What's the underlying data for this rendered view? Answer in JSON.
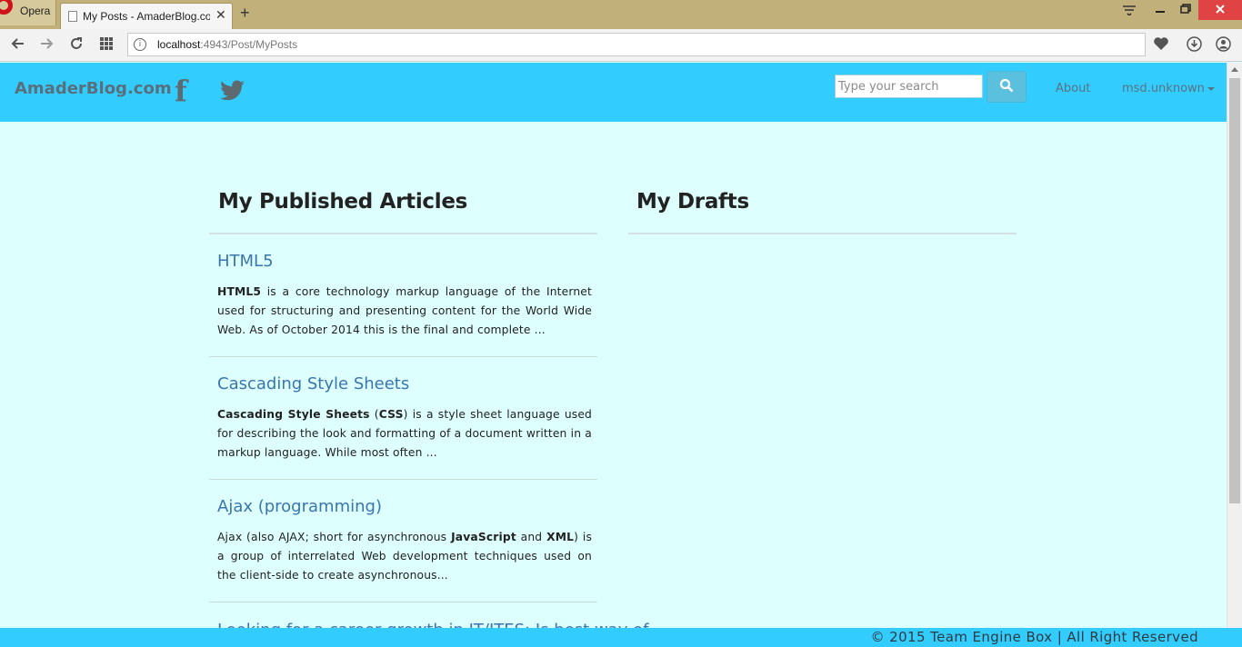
{
  "browser": {
    "menu_label": "Opera",
    "tab_title": "My Posts - AmaderBlog.co",
    "new_tab": "+",
    "tab_close": "✕",
    "url_host": "localhost",
    "url_rest": ":4943/Post/MyPosts"
  },
  "navbar": {
    "brand": "AmaderBlog.com",
    "facebook_glyph": "f",
    "search_placeholder": "Type your search",
    "about_label": "About",
    "user_label": "msd.unknown"
  },
  "published": {
    "heading": "My Published Articles",
    "articles": [
      {
        "title": "HTML5",
        "bold": "HTML5",
        "text": " is a core technology markup language of the Internet used for structuring and presenting content for the World Wide Web. As of October 2014 this is the final and complete ..."
      },
      {
        "title": "Cascading Style Sheets",
        "bold1": "Cascading Style Sheets",
        "mid1": " (",
        "bold2": "CSS",
        "text": ") is a style sheet language used for describing the look and formatting of a document written in a markup language. While most often ..."
      },
      {
        "title": "Ajax (programming)",
        "pre": "Ajax (also AJAX; short for asynchronous ",
        "bold1": "JavaScript",
        "mid": " and ",
        "bold2": "XML",
        "text": ") is a group of interrelated Web development techniques used on the client-side to create asynchronous..."
      }
    ],
    "partial_title": "Looking for a career growth in IT/ITES: Is best way of"
  },
  "drafts": {
    "heading": "My Drafts"
  },
  "footer": {
    "text": "© 2015 Team Engine Box | All Right Reserved"
  },
  "colors": {
    "navbar": "#33ccff",
    "page_bg": "#ddfffe",
    "link": "#3a76ad",
    "search_button": "#5bc0de"
  }
}
